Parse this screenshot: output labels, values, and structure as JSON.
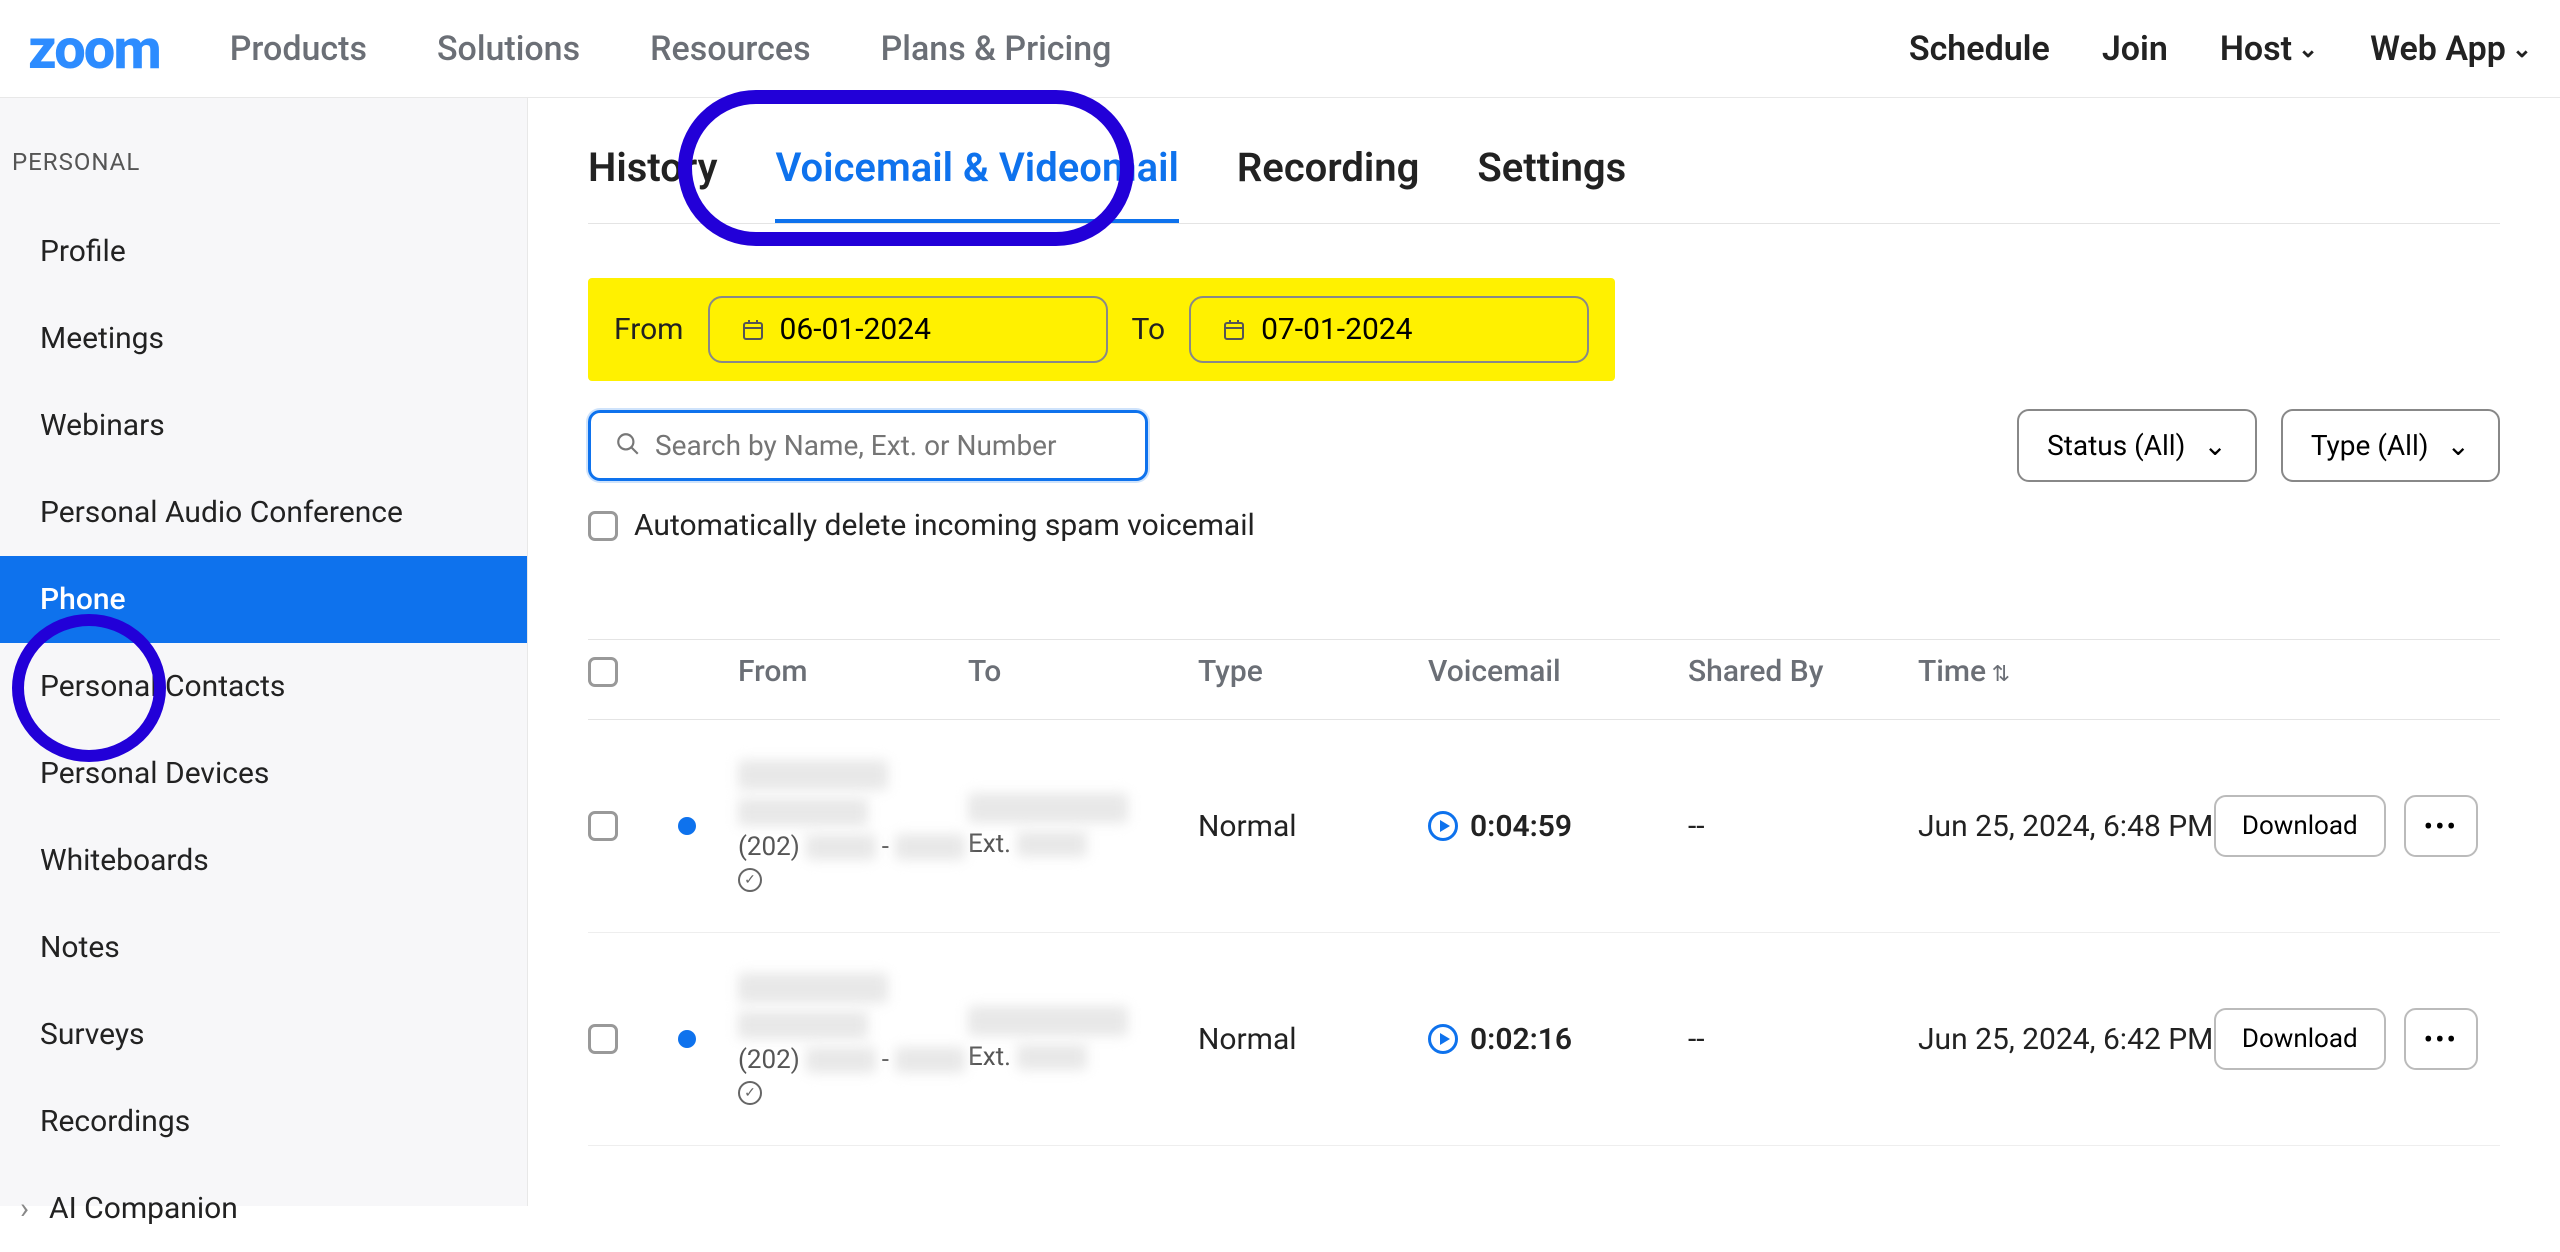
{
  "topnav": {
    "logo": "zoom",
    "left": [
      "Products",
      "Solutions",
      "Resources",
      "Plans & Pricing"
    ],
    "right": {
      "schedule": "Schedule",
      "join": "Join",
      "host": "Host",
      "webapp": "Web App"
    }
  },
  "sidebar": {
    "section": "PERSONAL",
    "items": [
      {
        "label": "Profile",
        "active": false
      },
      {
        "label": "Meetings",
        "active": false
      },
      {
        "label": "Webinars",
        "active": false
      },
      {
        "label": "Personal Audio Conference",
        "active": false
      },
      {
        "label": "Phone",
        "active": true
      },
      {
        "label": "Personal Contacts",
        "active": false
      },
      {
        "label": "Personal Devices",
        "active": false
      },
      {
        "label": "Whiteboards",
        "active": false
      },
      {
        "label": "Notes",
        "active": false
      },
      {
        "label": "Surveys",
        "active": false
      },
      {
        "label": "Recordings",
        "active": false
      },
      {
        "label": "AI Companion",
        "active": false
      }
    ]
  },
  "tabs": {
    "items": [
      "History",
      "Voicemail & Videomail",
      "Recording",
      "Settings"
    ],
    "active_index": 1
  },
  "daterange": {
    "from_label": "From",
    "from_value": "06-01-2024",
    "to_label": "To",
    "to_value": "07-01-2024"
  },
  "search": {
    "placeholder": "Search by Name, Ext. or Number"
  },
  "filters": {
    "status_label": "Status (All)",
    "type_label": "Type (All)"
  },
  "auto_delete_label": "Automatically delete incoming spam voicemail",
  "table": {
    "headers": {
      "from": "From",
      "to": "To",
      "type": "Type",
      "voicemail": "Voicemail",
      "shared_by": "Shared By",
      "time": "Time"
    },
    "rows": [
      {
        "unread": true,
        "from_phone_prefix": "(202)",
        "to_ext_label": "Ext.",
        "type": "Normal",
        "duration": "0:04:59",
        "shared_by": "--",
        "time": "Jun 25, 2024, 6:48 PM",
        "download": "Download"
      },
      {
        "unread": true,
        "from_phone_prefix": "(202)",
        "to_ext_label": "Ext.",
        "type": "Normal",
        "duration": "0:02:16",
        "shared_by": "--",
        "time": "Jun 25, 2024, 6:42 PM",
        "download": "Download"
      }
    ]
  }
}
